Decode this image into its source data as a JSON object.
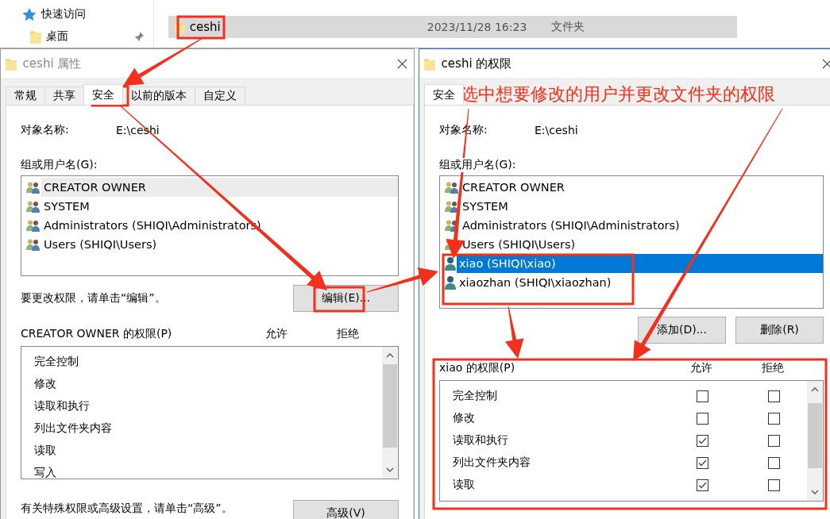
{
  "explorer": {
    "nav_items": [
      {
        "label": "快速访问",
        "kind": "quick",
        "pinned": false
      },
      {
        "label": "桌面",
        "kind": "folder",
        "pinned": true
      }
    ],
    "file_row": {
      "name": "ceshi",
      "modified": "2023/11/28 16:23",
      "type": "文件夹",
      "selected": true
    }
  },
  "properties_dialog": {
    "title": "ceshi 属性",
    "active": false,
    "tabs": [
      {
        "label": "常规",
        "selected": false
      },
      {
        "label": "共享",
        "selected": false
      },
      {
        "label": "安全",
        "selected": true
      },
      {
        "label": "以前的版本",
        "selected": false
      },
      {
        "label": "自定义",
        "selected": false
      }
    ],
    "object_label": "对象名称:",
    "object_value": "E:\\ceshi",
    "users_label": "组或用户名(G):",
    "users": [
      {
        "name": "CREATOR OWNER",
        "kind": "group",
        "selected": false,
        "highlighted": true
      },
      {
        "name": "SYSTEM",
        "kind": "group",
        "selected": false,
        "highlighted": false
      },
      {
        "name": "Administrators (SHIQI\\Administrators)",
        "kind": "group",
        "selected": false,
        "highlighted": false
      },
      {
        "name": "Users (SHIQI\\Users)",
        "kind": "group",
        "selected": false,
        "highlighted": false
      }
    ],
    "edit_hint": "要更改权限，请单击“编辑”。",
    "edit_button": "编辑(E)...",
    "permissions_label": "CREATOR OWNER 的权限(P)",
    "allow_header": "允许",
    "deny_header": "拒绝",
    "permissions": [
      {
        "name": "完全控制"
      },
      {
        "name": "修改"
      },
      {
        "name": "读取和执行"
      },
      {
        "name": "列出文件夹内容"
      },
      {
        "name": "读取"
      },
      {
        "name": "写入"
      }
    ],
    "advanced_hint": "有关特殊权限或高级设置，请单击“高级”。",
    "advanced_button": "高级(V)"
  },
  "permissions_dialog": {
    "title": "ceshi 的权限",
    "active": true,
    "tabs": [
      {
        "label": "安全",
        "selected": true
      }
    ],
    "object_label": "对象名称:",
    "object_value": "E:\\ceshi",
    "users_label": "组或用户名(G):",
    "users": [
      {
        "name": "CREATOR OWNER",
        "kind": "group",
        "selected": false,
        "highlighted": false
      },
      {
        "name": "SYSTEM",
        "kind": "group",
        "selected": false,
        "highlighted": false
      },
      {
        "name": "Administrators (SHIQI\\Administrators)",
        "kind": "group",
        "selected": false,
        "highlighted": false
      },
      {
        "name": "Users (SHIQI\\Users)",
        "kind": "group",
        "selected": false,
        "highlighted": false
      },
      {
        "name": "xiao (SHIQI\\xiao)",
        "kind": "user",
        "selected": true,
        "highlighted": false
      },
      {
        "name": "xiaozhan (SHIQI\\xiaozhan)",
        "kind": "user",
        "selected": false,
        "highlighted": false
      }
    ],
    "add_button": "添加(D)...",
    "remove_button": "删除(R)",
    "permissions_label": "xiao 的权限(P)",
    "allow_header": "允许",
    "deny_header": "拒绝",
    "permissions": [
      {
        "name": "完全控制",
        "allow": false,
        "deny": false
      },
      {
        "name": "修改",
        "allow": false,
        "deny": false
      },
      {
        "name": "读取和执行",
        "allow": true,
        "deny": false
      },
      {
        "name": "列出文件夹内容",
        "allow": true,
        "deny": false
      },
      {
        "name": "读取",
        "allow": true,
        "deny": false
      }
    ]
  },
  "annotation": {
    "text": "选中想要修改的用户并更改文件夹的权限"
  }
}
